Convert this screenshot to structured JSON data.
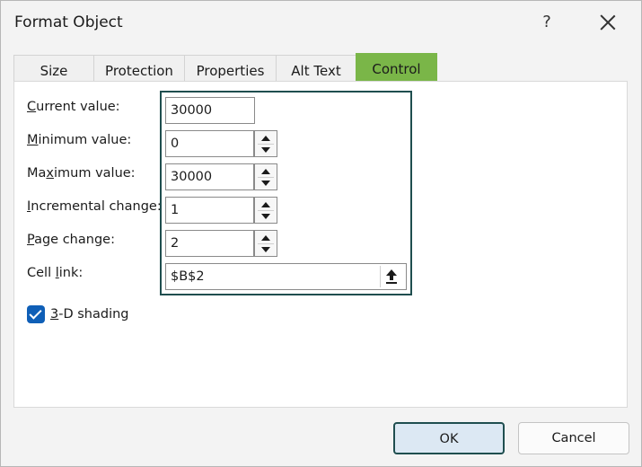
{
  "window": {
    "title": "Format Object",
    "help_label": "?",
    "close_label": "Close"
  },
  "tabs": [
    {
      "label": "Size",
      "active": false
    },
    {
      "label": "Protection",
      "active": false
    },
    {
      "label": "Properties",
      "active": false
    },
    {
      "label": "Alt Text",
      "active": false
    },
    {
      "label": "Control",
      "active": true
    }
  ],
  "control": {
    "current_value": {
      "pre": "",
      "accel": "C",
      "post": "urrent value:",
      "value": "30000"
    },
    "minimum_value": {
      "pre": "",
      "accel": "M",
      "post": "inimum value:",
      "value": "0"
    },
    "maximum_value": {
      "pre": "Ma",
      "accel": "x",
      "post": "imum value:",
      "value": "30000"
    },
    "incremental_change": {
      "pre": "",
      "accel": "I",
      "post": "ncremental change:",
      "value": "1"
    },
    "page_change": {
      "pre": "",
      "accel": "P",
      "post": "age change:",
      "value": "2"
    },
    "cell_link": {
      "pre": "Cell ",
      "accel": "l",
      "post": "ink:",
      "value": "$B$2"
    },
    "shading": {
      "pre": "",
      "accel": "3",
      "post": "-D shading",
      "checked": true
    }
  },
  "buttons": {
    "ok": "OK",
    "cancel": "Cancel"
  },
  "colors": {
    "active_tab": "#7ab648",
    "highlight_border": "#1f4e4f",
    "checkbox": "#0f5fb7"
  },
  "icons": {
    "close": "close-icon",
    "spin_up": "chevron-up-icon",
    "spin_down": "chevron-down-icon",
    "collapse": "collapse-dialog-icon",
    "checkmark": "checkmark-icon"
  }
}
